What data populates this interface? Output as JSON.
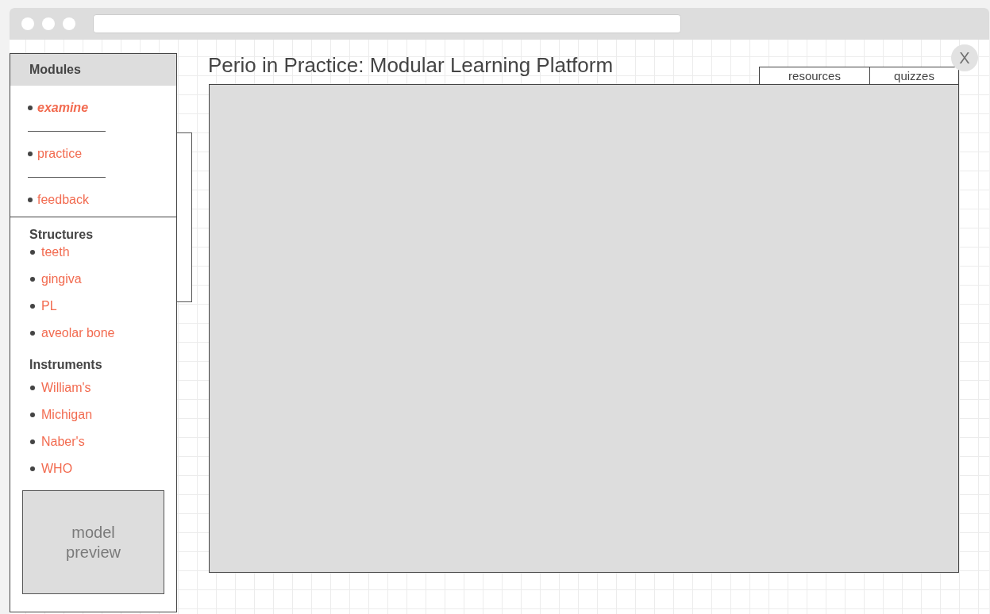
{
  "title": "Perio in Practice: Modular Learning Platform",
  "close": {
    "label": "X"
  },
  "tabs": [
    {
      "label": "resources",
      "selected": false
    },
    {
      "label": "quizzes",
      "selected": false
    }
  ],
  "sidebar": {
    "modules": {
      "heading": "Modules",
      "items": [
        {
          "label": "examine",
          "selected": true
        },
        {
          "label": "practice",
          "selected": false
        },
        {
          "label": "feedback",
          "selected": false
        }
      ]
    },
    "sections": [
      {
        "heading": "Structures",
        "items": [
          "teeth",
          "gingiva",
          "PL",
          "aveolar bone"
        ]
      },
      {
        "heading": "Instruments",
        "items": [
          "William's",
          "Michigan",
          "Naber's",
          "WHO"
        ]
      }
    ],
    "preview": "model preview"
  }
}
